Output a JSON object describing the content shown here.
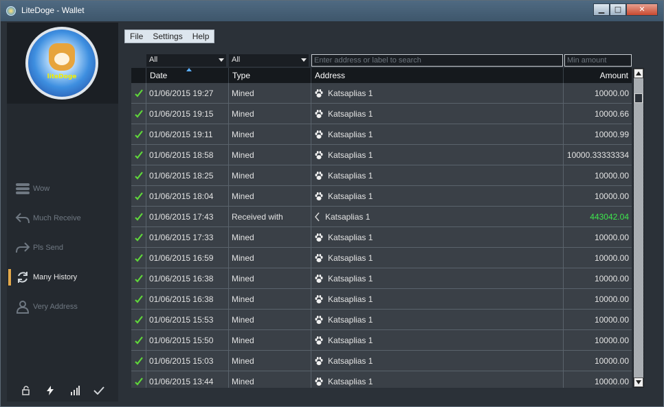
{
  "window": {
    "title": "LiteDoge - Wallet",
    "buttons": {
      "minimize": "▁",
      "maximize": "□",
      "close": "✕"
    }
  },
  "logo": {
    "text": "liteDoge"
  },
  "nav": {
    "items": [
      {
        "label": "Wow",
        "icon": "stack-icon",
        "active": false
      },
      {
        "label": "Much Receive",
        "icon": "receive-arrow-icon",
        "active": false
      },
      {
        "label": "Pls Send",
        "icon": "send-arrow-icon",
        "active": false
      },
      {
        "label": "Many History",
        "icon": "history-cycle-icon",
        "active": true
      },
      {
        "label": "Very Address",
        "icon": "person-icon",
        "active": false
      }
    ]
  },
  "status_icons": [
    "lock-icon",
    "lightning-icon",
    "signal-icon",
    "check-icon"
  ],
  "menu": {
    "file": "File",
    "settings": "Settings",
    "help": "Help"
  },
  "filters": {
    "date_filter": "All",
    "type_filter": "All",
    "search_placeholder": "Enter address or label to search",
    "min_amount_placeholder": "Min amount"
  },
  "table": {
    "headers": {
      "date": "Date",
      "type": "Type",
      "address": "Address",
      "amount": "Amount"
    },
    "rows": [
      {
        "date": "01/06/2015 19:27",
        "type": "Mined",
        "address": "Katsaplias 1",
        "amount": "10000.00",
        "kind": "mined"
      },
      {
        "date": "01/06/2015 19:15",
        "type": "Mined",
        "address": "Katsaplias 1",
        "amount": "10000.66",
        "kind": "mined"
      },
      {
        "date": "01/06/2015 19:11",
        "type": "Mined",
        "address": "Katsaplias 1",
        "amount": "10000.99",
        "kind": "mined"
      },
      {
        "date": "01/06/2015 18:58",
        "type": "Mined",
        "address": "Katsaplias 1",
        "amount": "10000.33333334",
        "kind": "mined"
      },
      {
        "date": "01/06/2015 18:25",
        "type": "Mined",
        "address": "Katsaplias 1",
        "amount": "10000.00",
        "kind": "mined"
      },
      {
        "date": "01/06/2015 18:04",
        "type": "Mined",
        "address": "Katsaplias 1",
        "amount": "10000.00",
        "kind": "mined"
      },
      {
        "date": "01/06/2015 17:43",
        "type": "Received with",
        "address": "Katsaplias 1",
        "amount": "443042.04",
        "kind": "received"
      },
      {
        "date": "01/06/2015 17:33",
        "type": "Mined",
        "address": "Katsaplias 1",
        "amount": "10000.00",
        "kind": "mined"
      },
      {
        "date": "01/06/2015 16:59",
        "type": "Mined",
        "address": "Katsaplias 1",
        "amount": "10000.00",
        "kind": "mined"
      },
      {
        "date": "01/06/2015 16:38",
        "type": "Mined",
        "address": "Katsaplias 1",
        "amount": "10000.00",
        "kind": "mined"
      },
      {
        "date": "01/06/2015 16:38",
        "type": "Mined",
        "address": "Katsaplias 1",
        "amount": "10000.00",
        "kind": "mined"
      },
      {
        "date": "01/06/2015 15:53",
        "type": "Mined",
        "address": "Katsaplias 1",
        "amount": "10000.00",
        "kind": "mined"
      },
      {
        "date": "01/06/2015 15:50",
        "type": "Mined",
        "address": "Katsaplias 1",
        "amount": "10000.00",
        "kind": "mined"
      },
      {
        "date": "01/06/2015 15:03",
        "type": "Mined",
        "address": "Katsaplias 1",
        "amount": "10000.00",
        "kind": "mined"
      },
      {
        "date": "01/06/2015 13:44",
        "type": "Mined",
        "address": "Katsaplias 1",
        "amount": "10000.00",
        "kind": "mined"
      }
    ]
  },
  "colors": {
    "accent": "#e3a94b",
    "received_amount": "#3de84c",
    "confirmed_check": "#5fd63a"
  }
}
